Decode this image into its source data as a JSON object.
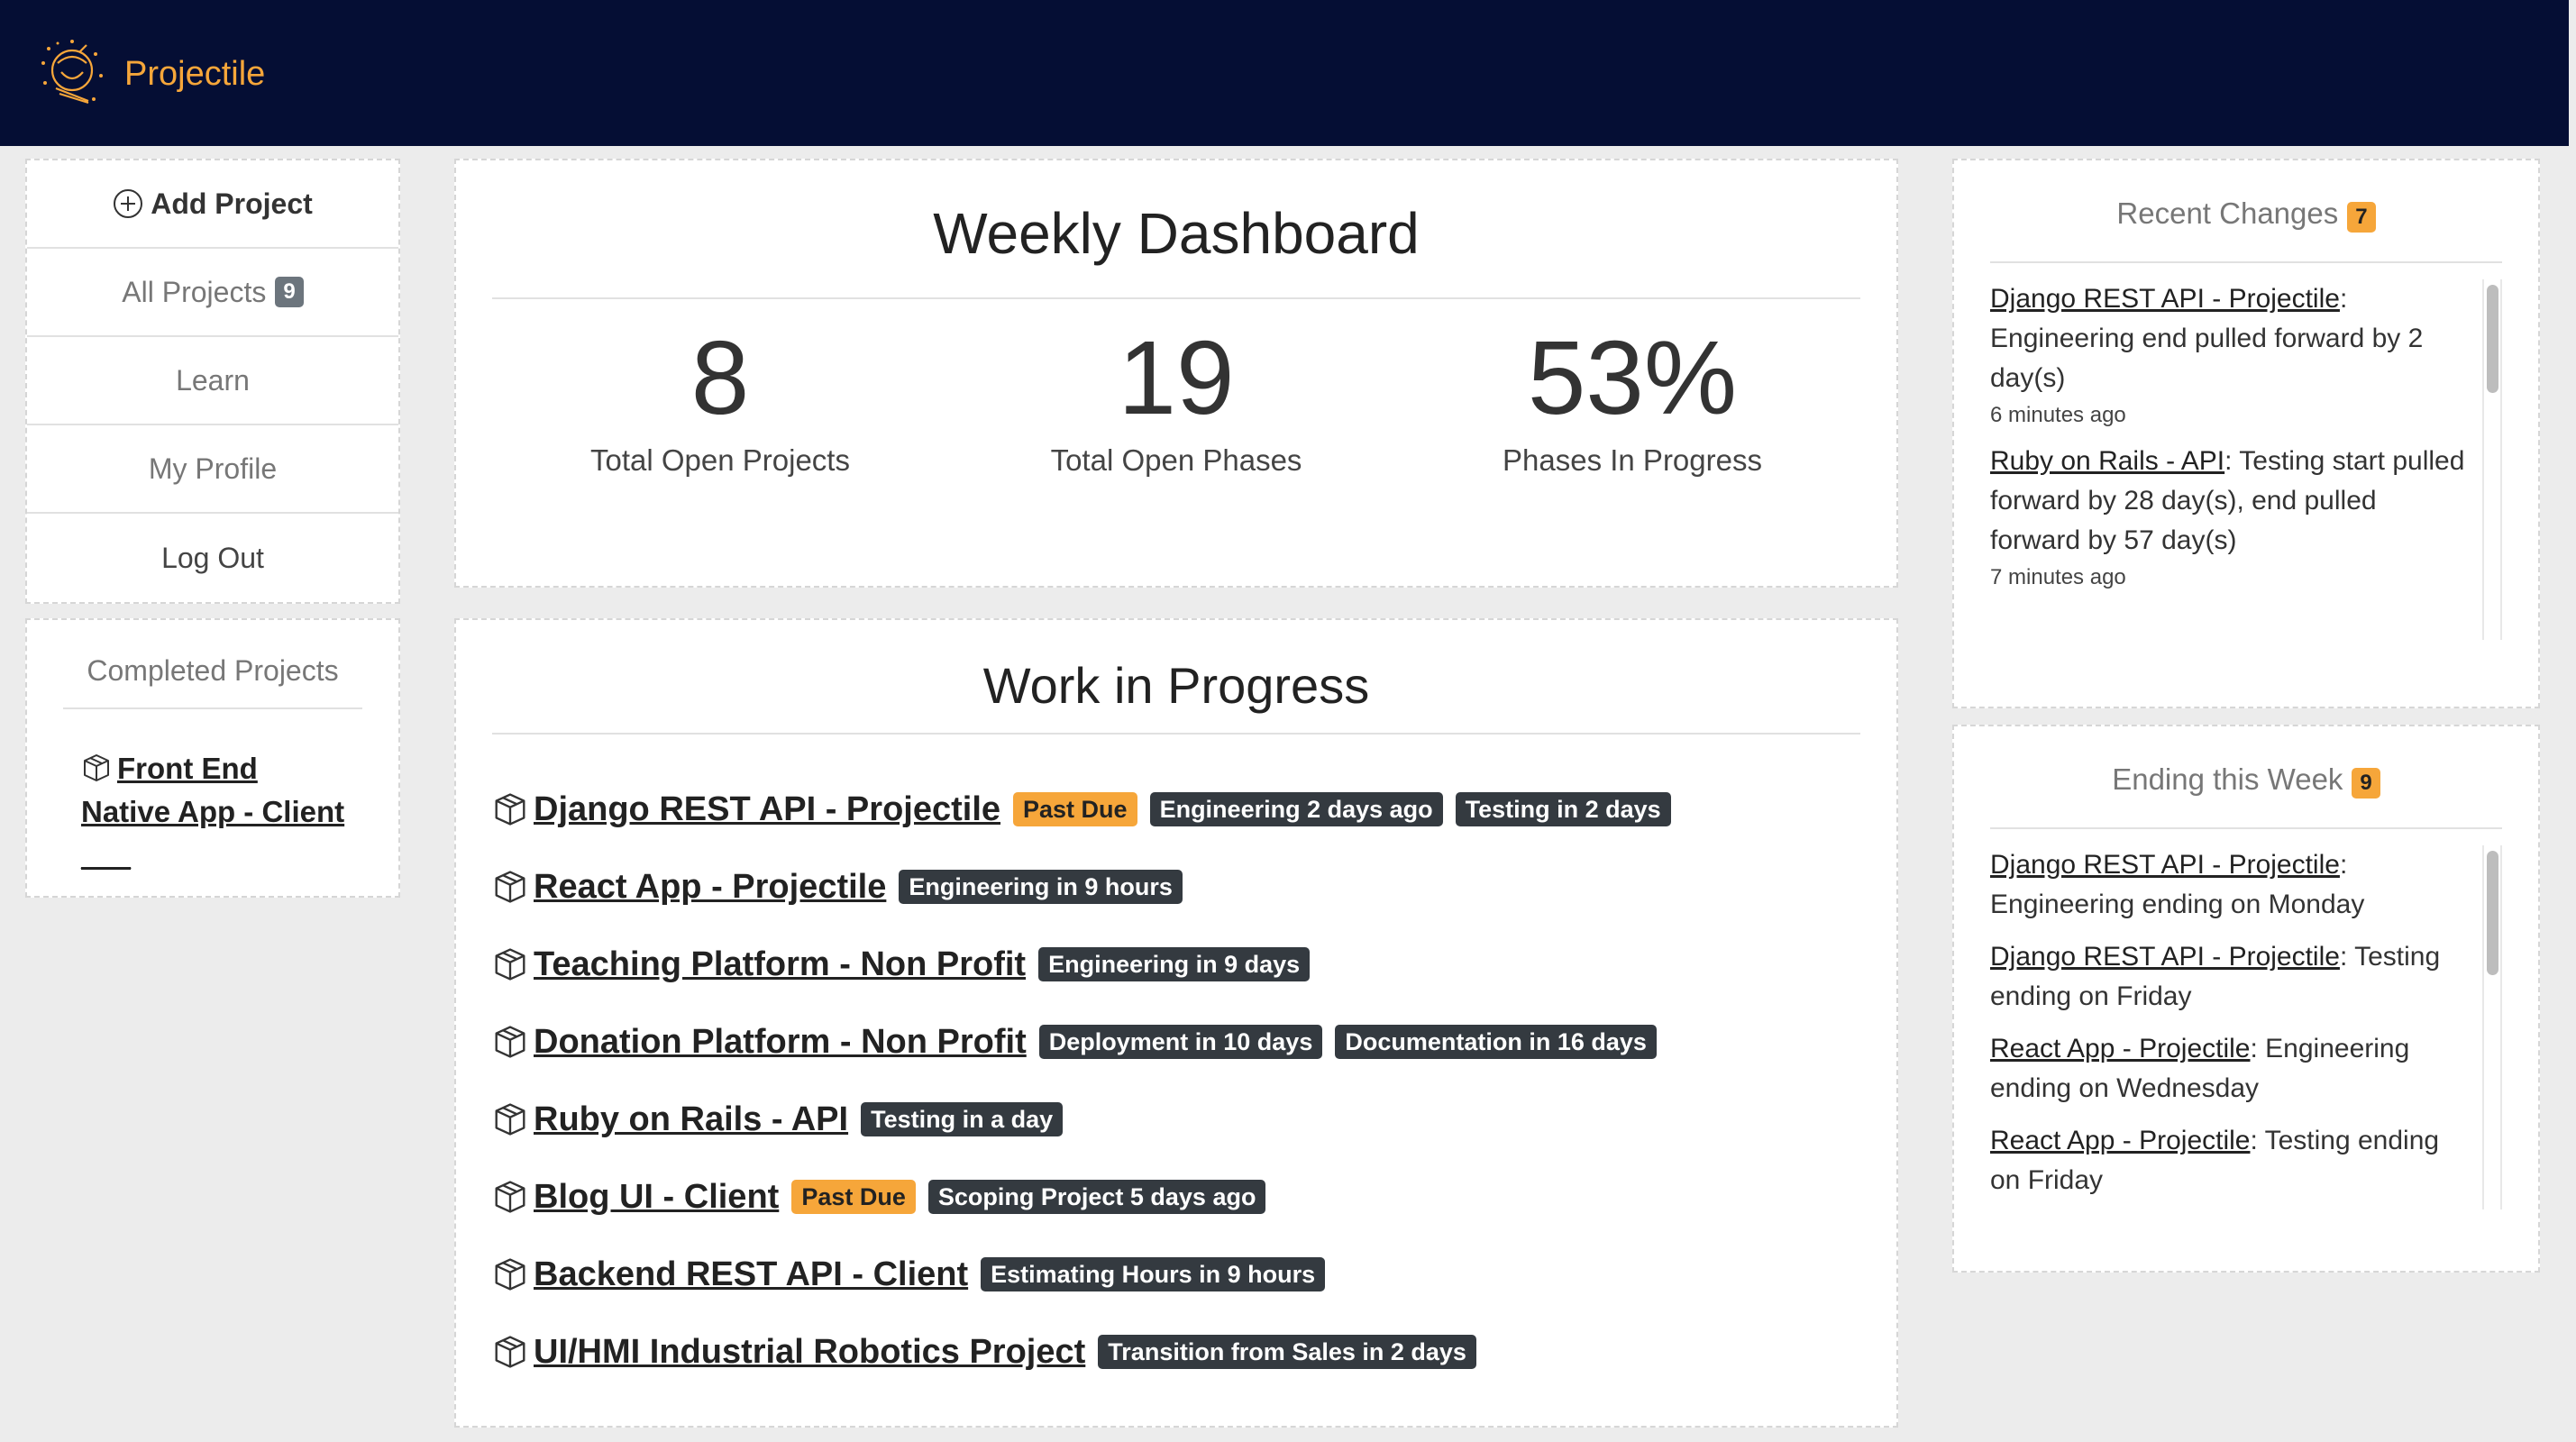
{
  "brand": {
    "name": "Projectile",
    "logo_icon": "astronaut-helmet-icon",
    "accent": "#f6a63a",
    "navbar_bg": "#050e34"
  },
  "sidebar": {
    "add_project": "Add Project",
    "items": [
      {
        "label": "All Projects",
        "badge": "9"
      },
      {
        "label": "Learn"
      },
      {
        "label": "My Profile"
      },
      {
        "label": "Log Out"
      }
    ]
  },
  "completed": {
    "title": "Completed Projects",
    "items": [
      {
        "name": "Front End Native App - Client ___"
      }
    ]
  },
  "weekly": {
    "title": "Weekly Dashboard",
    "stats": [
      {
        "value": "8",
        "label": "Total Open Projects"
      },
      {
        "value": "19",
        "label": "Total Open Phases"
      },
      {
        "value": "53%",
        "label": "Phases In Progress"
      }
    ]
  },
  "wip": {
    "title": "Work in Progress",
    "projects": [
      {
        "name": "Django REST API - Projectile",
        "tags": [
          {
            "text": "Past Due",
            "style": "warn"
          },
          {
            "text": "Engineering 2 days ago",
            "style": "dark"
          },
          {
            "text": "Testing in 2 days",
            "style": "dark"
          }
        ]
      },
      {
        "name": "React App - Projectile",
        "tags": [
          {
            "text": "Engineering in 9 hours",
            "style": "dark"
          }
        ]
      },
      {
        "name": "Teaching Platform - Non Profit",
        "tags": [
          {
            "text": "Engineering in 9 days",
            "style": "dark"
          }
        ]
      },
      {
        "name": "Donation Platform - Non Profit",
        "tags": [
          {
            "text": "Deployment in 10 days",
            "style": "dark"
          },
          {
            "text": "Documentation in 16 days",
            "style": "dark"
          }
        ]
      },
      {
        "name": "Ruby on Rails - API",
        "tags": [
          {
            "text": "Testing in a day",
            "style": "dark"
          }
        ]
      },
      {
        "name": "Blog UI - Client",
        "tags": [
          {
            "text": "Past Due",
            "style": "warn"
          },
          {
            "text": "Scoping Project 5 days ago",
            "style": "dark"
          }
        ]
      },
      {
        "name": "Backend REST API - Client",
        "tags": [
          {
            "text": "Estimating Hours in 9 hours",
            "style": "dark"
          }
        ]
      },
      {
        "name": "UI/HMI Industrial Robotics Project",
        "tags": [
          {
            "text": "Transition from Sales in 2 days",
            "style": "dark"
          }
        ]
      }
    ]
  },
  "recent_changes": {
    "title": "Recent Changes",
    "badge": "7",
    "items": [
      {
        "link": "Django REST API - Projectile",
        "text": ": Engineering end pulled forward by 2 day(s)",
        "time": "6 minutes ago"
      },
      {
        "link": "Ruby on Rails - API",
        "text": ": Testing start pulled forward by 28 day(s), end pulled forward by 57 day(s)",
        "time": "7 minutes ago"
      }
    ]
  },
  "ending_week": {
    "title": "Ending this Week",
    "badge": "9",
    "items": [
      {
        "link": "Django REST API - Projectile",
        "text": ": Engineering ending on Monday"
      },
      {
        "link": "Django REST API - Projectile",
        "text": ": Testing ending on Friday"
      },
      {
        "link": "React App - Projectile",
        "text": ": Engineering ending on Wednesday"
      },
      {
        "link": "React App - Projectile",
        "text": ": Testing ending on Friday"
      }
    ]
  }
}
